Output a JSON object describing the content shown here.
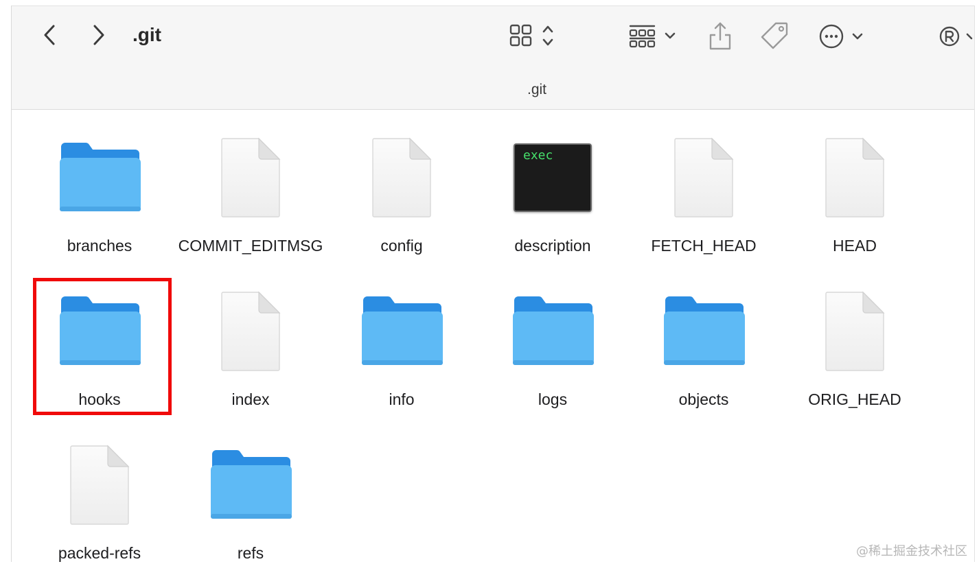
{
  "window": {
    "title": ".git",
    "path_title": ".git"
  },
  "toolbar": {
    "back_icon": "chevron-left-icon",
    "forward_icon": "chevron-right-icon",
    "view_mode_icon": "grid-view-icon",
    "group_icon": "group-by-icon",
    "share_icon": "share-icon",
    "tag_icon": "tag-icon",
    "more_icon": "ellipsis-circle-icon",
    "account_icon": "registered-icon"
  },
  "items": [
    {
      "name": "branches",
      "kind": "folder"
    },
    {
      "name": "COMMIT_EDITMSG",
      "kind": "file"
    },
    {
      "name": "config",
      "kind": "file"
    },
    {
      "name": "description",
      "kind": "exec",
      "badge": "exec"
    },
    {
      "name": "FETCH_HEAD",
      "kind": "file"
    },
    {
      "name": "HEAD",
      "kind": "file"
    },
    {
      "name": "hooks",
      "kind": "folder",
      "highlighted": true
    },
    {
      "name": "index",
      "kind": "file"
    },
    {
      "name": "info",
      "kind": "folder"
    },
    {
      "name": "logs",
      "kind": "folder"
    },
    {
      "name": "objects",
      "kind": "folder"
    },
    {
      "name": "ORIG_HEAD",
      "kind": "file"
    },
    {
      "name": "packed-refs",
      "kind": "file"
    },
    {
      "name": "refs",
      "kind": "folder"
    }
  ],
  "colors": {
    "folder_top": "#2b8de2",
    "folder_body": "#5ebaf5",
    "highlight": "#f00a0a",
    "toolbar_bg": "#f6f6f6"
  },
  "watermark": "@稀土掘金技术社区"
}
